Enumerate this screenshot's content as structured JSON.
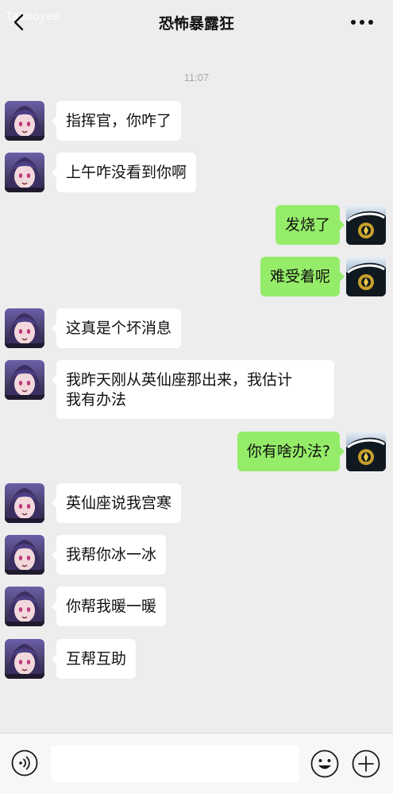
{
  "header": {
    "title": "恐怖暴露狂",
    "watermark": "Tabooyeo",
    "back_icon": "chevron-left-icon",
    "more_icon": "more-horizontal-icon"
  },
  "chat": {
    "timestamp": "11:07",
    "messages": [
      {
        "side": "left",
        "text": "指挥官，你咋了"
      },
      {
        "side": "left",
        "text": "上午咋没看到你啊"
      },
      {
        "side": "right",
        "text": "发烧了"
      },
      {
        "side": "right",
        "text": "难受着呢"
      },
      {
        "side": "left",
        "text": "这真是个坏消息"
      },
      {
        "side": "left",
        "lines": [
          "我昨天刚从英仙座那出来，我估计",
          "我有办法"
        ]
      },
      {
        "side": "right",
        "text": "你有啥办法?"
      },
      {
        "side": "left",
        "text": "英仙座说我宫寒"
      },
      {
        "side": "left",
        "text": "我帮你冰一冰"
      },
      {
        "side": "left",
        "text": "你帮我暖一暖"
      },
      {
        "side": "left",
        "text": "互帮互助"
      }
    ]
  },
  "composer": {
    "input_value": "",
    "voice_icon": "voice-icon",
    "emoji_icon": "emoji-icon",
    "plus_icon": "plus-icon"
  },
  "colors": {
    "background": "#ededed",
    "sent_bubble": "#95ec69",
    "received_bubble": "#ffffff"
  }
}
